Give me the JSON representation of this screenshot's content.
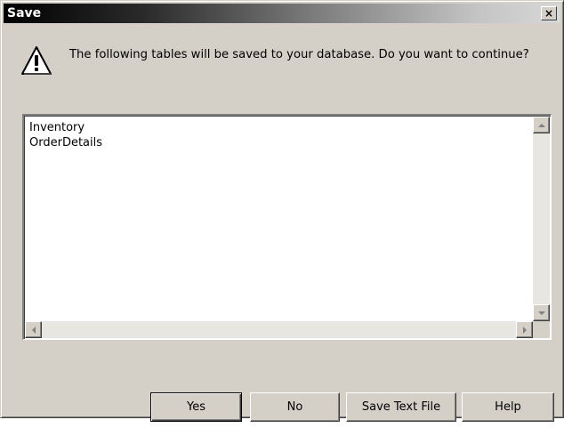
{
  "window": {
    "title": "Save",
    "close_glyph": "×"
  },
  "dialog": {
    "icon": "warning-icon",
    "message": "The following tables will be saved to your database. Do you want to continue?"
  },
  "list": {
    "items": [
      "Inventory",
      "OrderDetails"
    ]
  },
  "buttons": {
    "yes": "Yes",
    "no": "No",
    "save_text_file": "Save Text File",
    "help": "Help"
  },
  "colors": {
    "face": "#d4d0c8",
    "titlebar_start": "#000000",
    "titlebar_end": "#d8d8d8"
  }
}
